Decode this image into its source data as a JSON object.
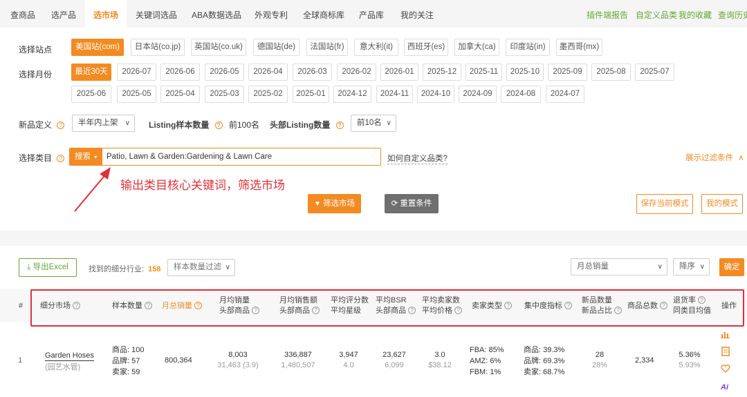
{
  "nav": {
    "tabs": [
      "查商品",
      "选产品",
      "选市场",
      "关键词选品",
      "ABA数据选品",
      "外观专利",
      "全球商标库",
      "产品库",
      "我的关注"
    ],
    "active": "选市场",
    "right_links": [
      "插件端报告",
      "自定义品类",
      "我的收藏",
      "查询历史"
    ]
  },
  "filters": {
    "site_label": "选择站点",
    "sites": [
      "美国站(com)",
      "日本站(co.jp)",
      "英国站(co.uk)",
      "德国站(de)",
      "法国站(fr)",
      "意大利(it)",
      "西班牙(es)",
      "加拿大(ca)",
      "印度站(in)",
      "墨西哥(mx)"
    ],
    "month_label": "选择月份",
    "months_row1": [
      "最近30天",
      "2026-07",
      "2026-06",
      "2026-05",
      "2026-04",
      "2026-03",
      "2026-02",
      "2026-01",
      "2025-12",
      "2025-11",
      "2025-10",
      "2025-09",
      "2025-08",
      "2025-07"
    ],
    "months_row2": [
      "2025-06",
      "2025-05",
      "2025-04",
      "2025-03",
      "2025-02",
      "2025-01",
      "2024-12",
      "2024-11",
      "2024-10",
      "2024-09",
      "2024-08",
      "2024-07"
    ],
    "new_def_label": "新品定义",
    "new_def_value": "半年内上架",
    "listing_label": "Listing样本数量",
    "listing_value": "前100名",
    "head_listing_label": "头部Listing数量",
    "head_listing_value": "前10名",
    "category_label": "选择类目",
    "search_btn": "搜索",
    "category_value": "Patio, Lawn & Garden:Gardening & Lawn Care",
    "custom_link": "如何自定义品类?",
    "expand_link": "展示过滤条件",
    "annotation": "输出类目核心关键词，筛选市场"
  },
  "actions": {
    "filter_btn": "筛选市场",
    "reset_btn": "重置条件",
    "save_mode_btn": "保存当前模式",
    "my_mode_btn": "我的模式"
  },
  "results": {
    "export_btn": "导出Excel",
    "found_label": "找到的细分行业:",
    "found_count": "158",
    "sample_filter": "样本数量过滤",
    "sort_field": "月总销量",
    "sort_order": "降序",
    "confirm_btn": "确定"
  },
  "table": {
    "headers": {
      "index": "#",
      "market": "细分市场",
      "sample": "样本数量",
      "monthly_sales": "月总销量",
      "avg_sales_1": "月均销量",
      "avg_sales_2": "头部商品",
      "avg_revenue_1": "月均销售额",
      "avg_revenue_2": "头部商品",
      "avg_reviews_1": "平均评分数",
      "avg_reviews_2": "平均星级",
      "avg_bsr_1": "平均BSR",
      "avg_bsr_2": "头部商品",
      "avg_sellers_1": "平均卖家数",
      "avg_sellers_2": "平均价格",
      "seller_type": "卖家类型",
      "concentration": "集中度指标",
      "new_1": "新品数量",
      "new_2": "新品占比",
      "total": "商品总数",
      "return_1": "退货率",
      "return_2": "同类目均值",
      "ops": "操作"
    },
    "rows": [
      {
        "index": "1",
        "market": "Garden Hoses",
        "market_cn": "(园艺水管)",
        "sample_products": "商品: 100",
        "sample_brands": "品牌: 57",
        "sample_sellers": "卖家: 59",
        "monthly_sales": "800,364",
        "avg_sales": "8,003",
        "avg_sales_head": "31,463 (3.9)",
        "avg_revenue": "336,887",
        "avg_revenue_head": "1,480,507",
        "avg_reviews": "3,947",
        "avg_stars": "4.0",
        "avg_bsr": "23,627",
        "avg_bsr_head": "6,099",
        "avg_sellers": "3.0",
        "avg_price": "$38.12",
        "fba": "FBA: 85%",
        "amz": "AMZ: 6%",
        "fbm": "FBM: 1%",
        "conc_products": "商品: 39.3%",
        "conc_brands": "品牌: 69.3%",
        "conc_sellers": "卖家: 68.7%",
        "new_count": "28",
        "new_ratio": "28%",
        "total": "2,334",
        "return_rate": "5.36%",
        "return_avg": "5.93%"
      }
    ]
  },
  "colors": {
    "accent": "#f28b22",
    "green": "#62a832",
    "red_box": "#e0303a"
  }
}
